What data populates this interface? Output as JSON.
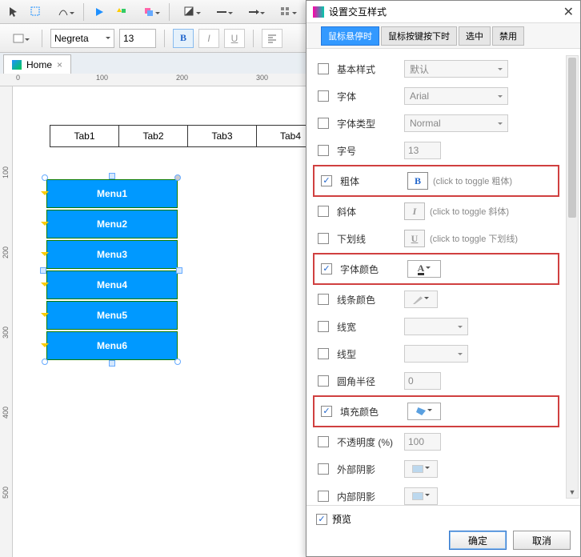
{
  "toolbar2": {
    "font": "Negreta",
    "size": "13"
  },
  "doctab": {
    "label": "Home"
  },
  "ruler_h": [
    "0",
    "100",
    "200",
    "300"
  ],
  "ruler_v": [
    "100",
    "200",
    "300",
    "400",
    "500"
  ],
  "tabs_row": [
    "Tab1",
    "Tab2",
    "Tab3",
    "Tab4"
  ],
  "menus": [
    "Menu1",
    "Menu2",
    "Menu3",
    "Menu4",
    "Menu5",
    "Menu6"
  ],
  "dialog": {
    "title": "设置交互样式",
    "tabs": [
      "鼠标悬停时",
      "鼠标按键按下时",
      "选中",
      "禁用"
    ],
    "rows": {
      "base": {
        "label": "基本样式",
        "value": "默认"
      },
      "font": {
        "label": "字体",
        "value": "Arial"
      },
      "fonttype": {
        "label": "字体类型",
        "value": "Normal"
      },
      "fontsize": {
        "label": "字号",
        "value": "13"
      },
      "bold": {
        "label": "粗体",
        "hint": "(click to toggle 粗体)"
      },
      "italic": {
        "label": "斜体",
        "hint": "(click to toggle 斜体)"
      },
      "underline": {
        "label": "下划线",
        "hint": "(click to toggle 下划线)"
      },
      "fontcolor": {
        "label": "字体颜色"
      },
      "linecolor": {
        "label": "线条颜色"
      },
      "linewidth": {
        "label": "线宽"
      },
      "linetype": {
        "label": "线型"
      },
      "radius": {
        "label": "圆角半径",
        "value": "0"
      },
      "fillcolor": {
        "label": "填充颜色"
      },
      "opacity": {
        "label": "不透明度 (%)",
        "value": "100"
      },
      "outershadow": {
        "label": "外部阴影"
      },
      "innershadow": {
        "label": "内部阴影"
      }
    },
    "preview": "预览",
    "ok": "确定",
    "cancel": "取消"
  }
}
